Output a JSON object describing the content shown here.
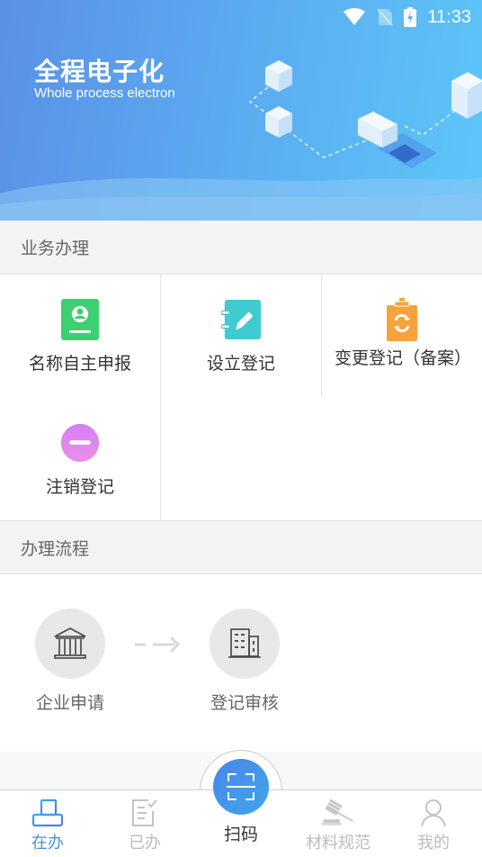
{
  "status_bar": {
    "time": "11:33",
    "icons": [
      "wifi-icon",
      "no-sim-icon",
      "battery-charging-icon"
    ]
  },
  "banner": {
    "title": "全程电子化",
    "subtitle": "Whole process electron"
  },
  "business_section": {
    "title": "业务办理",
    "items": [
      {
        "label": "名称自主申报",
        "icon": "name-card-icon",
        "color": "#3dcf72"
      },
      {
        "label": "设立登记",
        "icon": "notebook-edit-icon",
        "color": "#3fcbd0"
      },
      {
        "label": "变更登记（备案）",
        "icon": "clipboard-refresh-icon",
        "color": "#f7a33b"
      },
      {
        "label": "注销登记",
        "icon": "minus-circle-icon",
        "color": "#de86ee"
      }
    ]
  },
  "process_section": {
    "title": "办理流程",
    "steps": [
      {
        "label": "企业申请",
        "icon": "bank-icon"
      },
      {
        "label": "登记审核",
        "icon": "building-icon"
      }
    ]
  },
  "tabbar": {
    "active_color": "#4a8fe0",
    "inactive_color": "#bcbcbc",
    "tabs": [
      {
        "label": "在办",
        "icon": "inbox-tray-icon",
        "active": true
      },
      {
        "label": "已办",
        "icon": "checked-doc-icon",
        "active": false
      },
      {
        "label": "扫码",
        "icon": "scan-icon",
        "active": false
      },
      {
        "label": "材料规范",
        "icon": "gavel-icon",
        "active": false
      },
      {
        "label": "我的",
        "icon": "person-icon",
        "active": false
      }
    ]
  }
}
